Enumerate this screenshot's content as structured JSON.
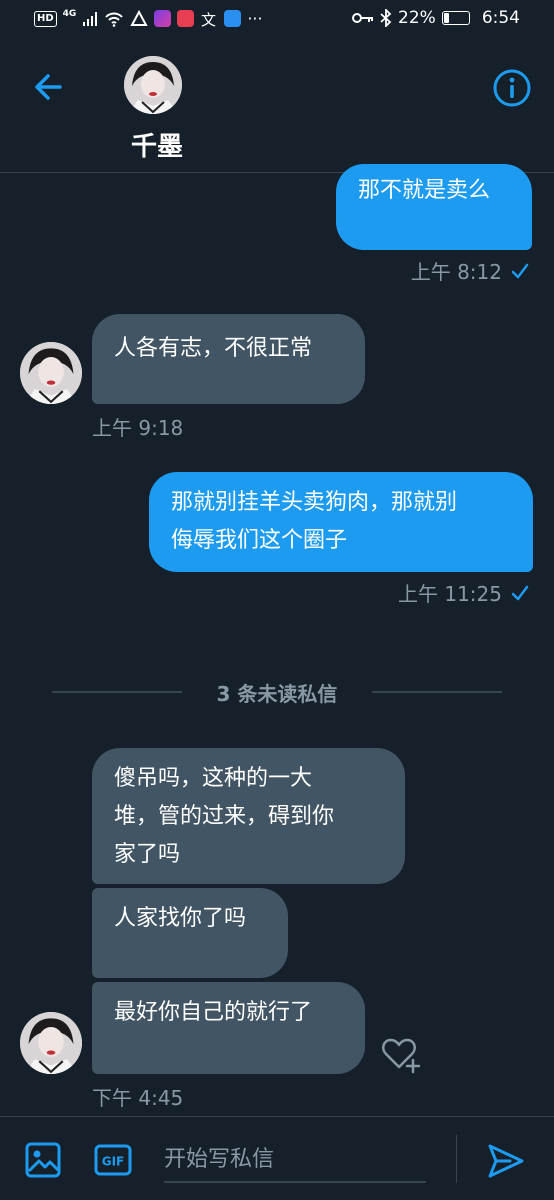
{
  "status_bar": {
    "hd_badge": "HD",
    "network": "4G",
    "battery_percent": 22,
    "battery_text": "22%",
    "time": "6:54",
    "overflow": "···"
  },
  "header": {
    "name": "千墨"
  },
  "messages": {
    "m1": {
      "text": "那不就是卖么",
      "time": "上午 8:12"
    },
    "m2": {
      "text": "人各有志，不很正常",
      "time": "上午 9:18"
    },
    "m3": {
      "line1": "那就别挂羊头卖狗肉，那就别",
      "line2": "侮辱我们这个圈子",
      "time": "上午 11:25"
    },
    "unread_label": "3 条未读私信",
    "m4": {
      "line1": "傻吊吗，这种的一大",
      "line2": "堆，管的过来，碍到你",
      "line3": "家了吗"
    },
    "m5": {
      "text": "人家找你了吗"
    },
    "m6": {
      "text": "最好你自己的就行了",
      "time": "下午 4:45"
    }
  },
  "composer": {
    "placeholder": "开始写私信",
    "gif_label": "GIF"
  },
  "colors": {
    "background": "#15202b",
    "accent": "#1d9bf0",
    "incoming_bubble": "#425565",
    "muted_text": "#8899a6"
  }
}
